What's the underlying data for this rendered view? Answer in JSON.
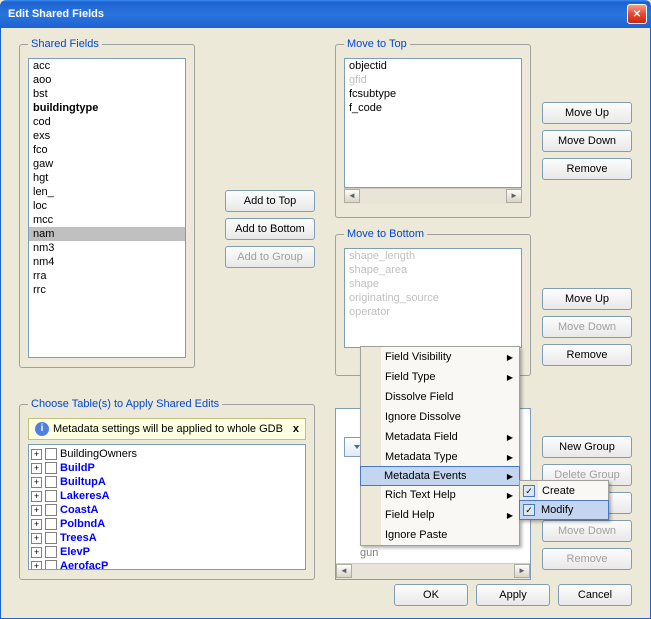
{
  "window": {
    "title": "Edit Shared Fields"
  },
  "shared_fields": {
    "legend": "Shared Fields",
    "items": [
      "acc",
      "aoo",
      "bst",
      "buildingtype",
      "cod",
      "exs",
      "fco",
      "gaw",
      "hgt",
      "len_",
      "loc",
      "mcc",
      "nam",
      "nm3",
      "nm4",
      "rra",
      "rrc"
    ],
    "bold_index": 3,
    "selected_index": 12
  },
  "add_buttons": {
    "top": "Add to Top",
    "bottom": "Add to Bottom",
    "group": "Add to Group"
  },
  "move_top": {
    "legend": "Move to Top",
    "items": [
      "objectid",
      "gfid",
      "fcsubtype",
      "f_code"
    ],
    "gray_idx": [
      1
    ]
  },
  "move_bottom": {
    "legend": "Move to Bottom",
    "items": [
      "shape_length",
      "shape_area",
      "shape",
      "originating_source",
      "operator"
    ],
    "gray_idx": [
      0,
      1,
      2,
      3,
      4
    ]
  },
  "right1": {
    "up": "Move Up",
    "down": "Move Down",
    "remove": "Remove"
  },
  "right2": {
    "up": "Move Up",
    "down": "Move Down",
    "remove": "Remove"
  },
  "right3": {
    "new": "New Group",
    "delete": "Delete Group",
    "up": "Move Up",
    "down": "Move Down",
    "remove": "Remove"
  },
  "groups": {
    "item_frag": "gun"
  },
  "choose": {
    "legend": "Choose Table(s) to Apply Shared Edits",
    "info": "Metadata settings will be applied to whole GDB",
    "items": [
      {
        "label": "BuildingOwners",
        "plain": true
      },
      {
        "label": "BuildP"
      },
      {
        "label": "BuiltupA"
      },
      {
        "label": "LakeresA"
      },
      {
        "label": "CoastA"
      },
      {
        "label": "PolbndA"
      },
      {
        "label": "TreesA"
      },
      {
        "label": "ElevP"
      },
      {
        "label": "AerofacP"
      }
    ]
  },
  "ctx": {
    "items": [
      {
        "label": "Field Visibility",
        "sub": true
      },
      {
        "label": "Field Type",
        "sub": true
      },
      {
        "label": "Dissolve Field"
      },
      {
        "label": "Ignore Dissolve"
      },
      {
        "label": "Metadata Field",
        "sub": true
      },
      {
        "label": "Metadata Type",
        "sub": true
      },
      {
        "label": "Metadata Events",
        "sub": true,
        "hover": true
      },
      {
        "label": "Rich Text Help",
        "sub": true
      },
      {
        "label": "Field Help",
        "sub": true
      },
      {
        "label": "Ignore Paste"
      }
    ],
    "sub": [
      {
        "label": "Create",
        "checked": true
      },
      {
        "label": "Modify",
        "checked": true,
        "hover": true
      }
    ]
  },
  "dlg": {
    "ok": "OK",
    "apply": "Apply",
    "cancel": "Cancel"
  }
}
